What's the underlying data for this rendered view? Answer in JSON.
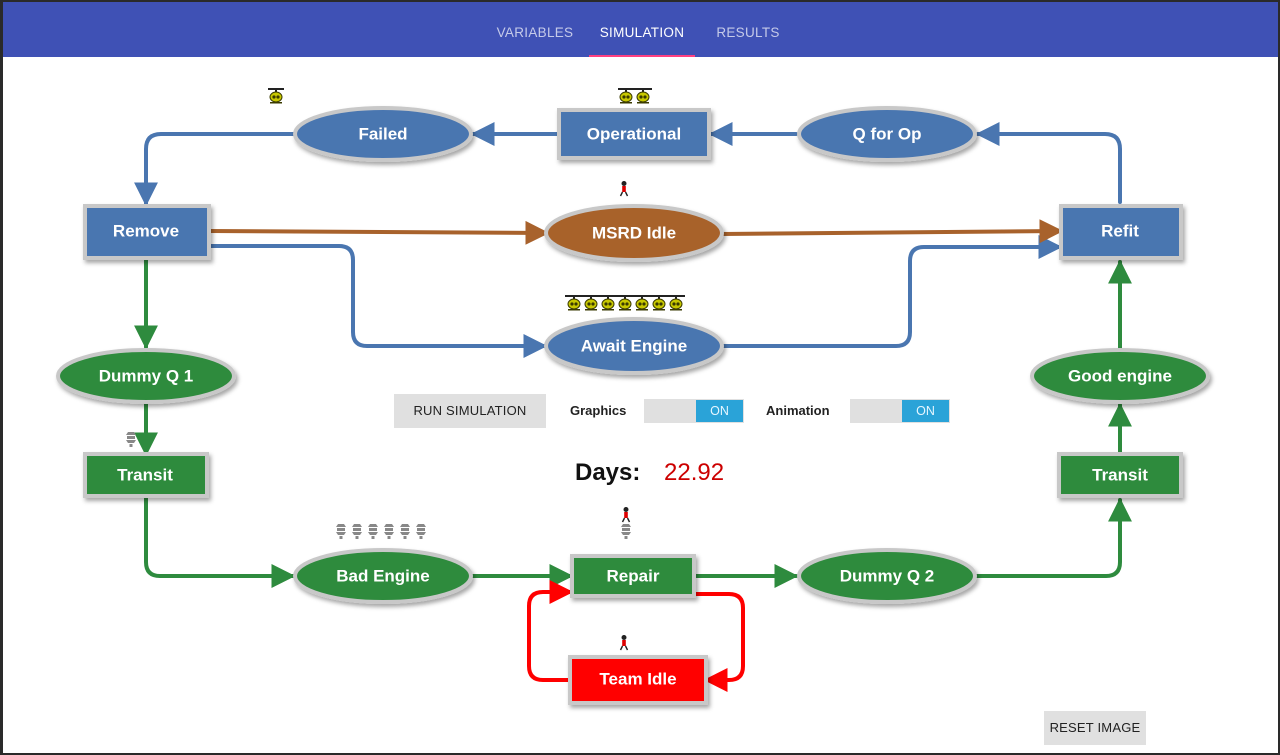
{
  "tabs": [
    {
      "label": "VARIABLES",
      "active": false
    },
    {
      "label": "SIMULATION",
      "active": true
    },
    {
      "label": "RESULTS",
      "active": false
    }
  ],
  "nodes": {
    "failed": "Failed",
    "operational": "Operational",
    "q_for_op": "Q for Op",
    "remove": "Remove",
    "msrd_idle": "MSRD Idle",
    "refit": "Refit",
    "await_engine": "Await Engine",
    "dummy_q1": "Dummy Q 1",
    "good_engine": "Good engine",
    "transit_left": "Transit",
    "transit_right": "Transit",
    "bad_engine": "Bad Engine",
    "repair": "Repair",
    "dummy_q2": "Dummy Q 2",
    "team_idle": "Team Idle"
  },
  "controls": {
    "run_button": "RUN SIMULATION",
    "graphics_label": "Graphics",
    "graphics_state": "ON",
    "animation_label": "Animation",
    "animation_state": "ON",
    "reset_button": "RESET IMAGE"
  },
  "clock": {
    "label": "Days:",
    "value": "22.92"
  },
  "colors": {
    "blue": "#4a76b0",
    "green": "#2e8b3e",
    "brown": "#a8622c",
    "red": "#ff0000",
    "header": "#3f51b5",
    "accent": "#ff4081",
    "days_value": "#cc0000"
  },
  "token_counts": {
    "failed_helicopters": 1,
    "operational_helicopters": 2,
    "await_engine_helicopters": 7,
    "msrd_idle_people": 1,
    "transit_left_engines": 1,
    "bad_engine_engines": 6,
    "repair_people": 1,
    "repair_engines": 1,
    "team_idle_people": 1
  }
}
